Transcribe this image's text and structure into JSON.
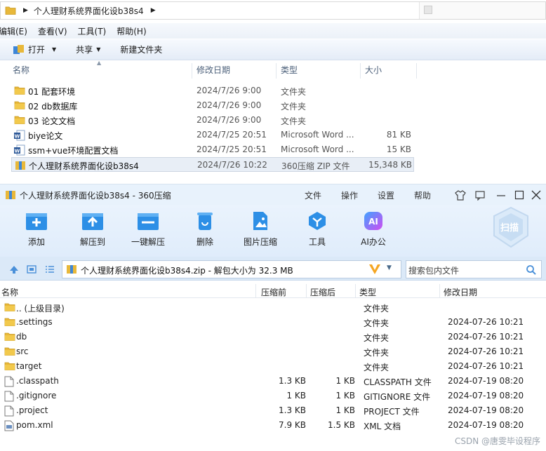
{
  "explorer": {
    "path": "个人理财系统界面化设b38s4",
    "menu": [
      "编辑(E)",
      "查看(V)",
      "工具(T)",
      "帮助(H)"
    ],
    "commands": {
      "open": "打开",
      "share": "共享",
      "new_folder": "新建文件夹"
    },
    "columns": {
      "name": "名称",
      "date": "修改日期",
      "type": "类型",
      "size": "大小"
    },
    "rows": [
      {
        "name": "01 配套环境",
        "date": "2024/7/26 9:00",
        "type": "文件夹",
        "size": "",
        "icon": "folder-icon"
      },
      {
        "name": "02 db数据库",
        "date": "2024/7/26 9:00",
        "type": "文件夹",
        "size": "",
        "icon": "folder-icon"
      },
      {
        "name": "03 论文文档",
        "date": "2024/7/26 9:00",
        "type": "文件夹",
        "size": "",
        "icon": "folder-icon"
      },
      {
        "name": "biye论文",
        "date": "2024/7/25 20:51",
        "type": "Microsoft Word ...",
        "size": "81 KB",
        "icon": "word-icon"
      },
      {
        "name": "ssm+vue环境配置文档",
        "date": "2024/7/25 20:51",
        "type": "Microsoft Word ...",
        "size": "15 KB",
        "icon": "word-icon"
      },
      {
        "name": "个人理财系统界面化设b38s4",
        "date": "2024/7/26 10:22",
        "type": "360压缩 ZIP 文件",
        "size": "15,348 KB",
        "icon": "zip-icon"
      }
    ]
  },
  "zip": {
    "title": "个人理财系统界面化设b38s4 - 360压缩",
    "title_menu": [
      "文件",
      "操作",
      "设置",
      "帮助"
    ],
    "tools": [
      {
        "label": "添加",
        "icon": "add-icon"
      },
      {
        "label": "解压到",
        "icon": "extract-to-icon"
      },
      {
        "label": "一键解压",
        "icon": "one-click-extract-icon"
      },
      {
        "label": "删除",
        "icon": "delete-icon"
      },
      {
        "label": "图片压缩",
        "icon": "image-compress-icon"
      },
      {
        "label": "工具",
        "icon": "tools-icon"
      },
      {
        "label": "AI办公",
        "icon": "ai-office-icon"
      }
    ],
    "ai_text": "AI",
    "scan_label": "扫描",
    "path_text": "个人理财系统界面化设b38s4.zip - 解包大小为 32.3 MB",
    "search_placeholder": "搜索包内文件",
    "columns": {
      "name": "名称",
      "packed_before": "压缩前",
      "packed_after": "压缩后",
      "type": "类型",
      "date": "修改日期"
    },
    "rows": [
      {
        "name": ".. (上级目录)",
        "before": "",
        "after": "",
        "type": "文件夹",
        "date": "",
        "icon": "folder-icon"
      },
      {
        "name": ".settings",
        "before": "",
        "after": "",
        "type": "文件夹",
        "date": "2024-07-26 10:21",
        "icon": "folder-icon"
      },
      {
        "name": "db",
        "before": "",
        "after": "",
        "type": "文件夹",
        "date": "2024-07-26 10:21",
        "icon": "folder-icon"
      },
      {
        "name": "src",
        "before": "",
        "after": "",
        "type": "文件夹",
        "date": "2024-07-26 10:21",
        "icon": "folder-icon"
      },
      {
        "name": "target",
        "before": "",
        "after": "",
        "type": "文件夹",
        "date": "2024-07-26 10:21",
        "icon": "folder-icon"
      },
      {
        "name": ".classpath",
        "before": "1.3 KB",
        "after": "1 KB",
        "type": "CLASSPATH 文件",
        "date": "2024-07-19 08:20",
        "icon": "file-icon"
      },
      {
        "name": ".gitignore",
        "before": "1 KB",
        "after": "1 KB",
        "type": "GITIGNORE 文件",
        "date": "2024-07-19 08:20",
        "icon": "file-icon"
      },
      {
        "name": ".project",
        "before": "1.3 KB",
        "after": "1 KB",
        "type": "PROJECT 文件",
        "date": "2024-07-19 08:20",
        "icon": "file-icon"
      },
      {
        "name": "pom.xml",
        "before": "7.9 KB",
        "after": "1.5 KB",
        "type": "XML 文档",
        "date": "2024-07-19 08:20",
        "icon": "xml-file-icon"
      }
    ]
  },
  "watermark": "CSDN @唐雯毕设程序",
  "colors": {
    "folder": "#e8b83a",
    "accent_blue": "#2d8fe6",
    "ai_gradient": "#9b5cf6",
    "zip_title_bg": "#e8f2fc"
  }
}
